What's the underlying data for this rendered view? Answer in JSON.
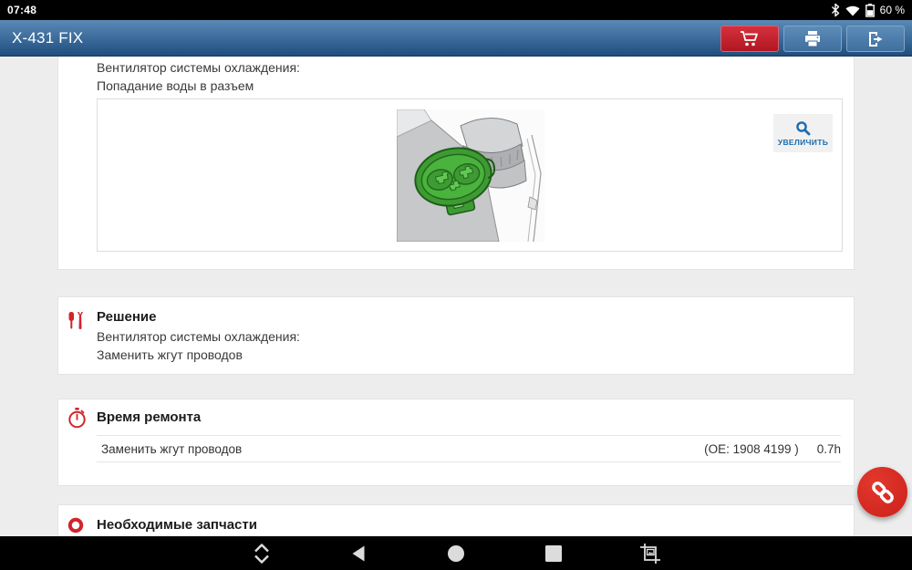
{
  "status_bar": {
    "time": "07:48",
    "battery_level": "60 %"
  },
  "app_bar": {
    "title": "X-431 FIX"
  },
  "cards": {
    "fault": {
      "line1": "Вентилятор системы охлаждения:",
      "line2": "Попадание воды в разъем",
      "zoom_label": "УВЕЛИЧИТЬ"
    },
    "solution": {
      "title": "Решение",
      "line1": "Вентилятор системы охлаждения:",
      "line2": "Заменить жгут проводов"
    },
    "repair_time": {
      "title": "Время ремонта",
      "rows": [
        {
          "name": "Заменить жгут проводов",
          "oe": "(OE: 1908 4199 )",
          "hours": "0.7h"
        }
      ]
    },
    "parts": {
      "title": "Необходимые запчасти"
    }
  },
  "icons": {
    "app_actions": [
      "cart-icon",
      "printer-icon",
      "exit-icon"
    ],
    "nav": [
      "collapse-icon",
      "back-icon",
      "home-icon",
      "recents-icon",
      "screenshot-icon"
    ]
  },
  "colors": {
    "accent_red": "#c3202c",
    "tool_red": "#d3232b",
    "fab_red": "#d8261d",
    "link_blue": "#1a6cae",
    "app_bar_top": "#5b89b6",
    "app_bar_bottom": "#1f4e7c"
  }
}
